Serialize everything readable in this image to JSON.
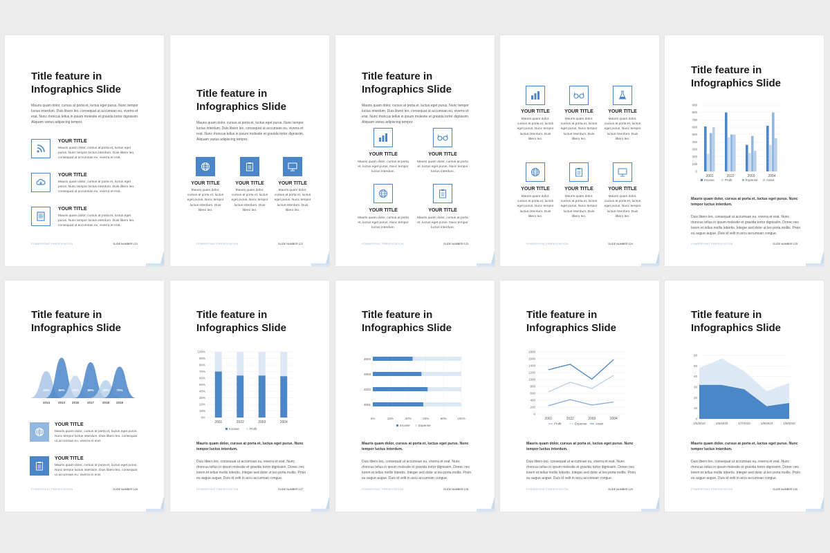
{
  "common": {
    "title_line1": "Title feature in",
    "title_line2": "Infographics Slide",
    "footer_left": "POWERPOINT PRESENTATION",
    "intro": "Mauris quam dolor, cursus at porta et, luctus eget purus. Nunc tempor luctus interdum. Duis libero leo, consequat ut accumsan eu, viverra et erat. Nunc rhoncus tellus in ipsum molestie et gravida tortor dignissim. Aliquam varius adipiscing tempor.",
    "item_title": "YOUR TITLE",
    "item_text_wide": "Mauris quam dolor, cursus at porta et, luctus eget purus. Nunc tempor luctus interdum. Duis libero leo, consequat ut accumsan eu, viverra et erat.",
    "item_text_narrow": "Mauris quam dolor, cursus at porta et, luctus eget purus. Nunc tempor luctus interdum.",
    "item_text_col": "Mauris quam dolor, cursus at porta et, luctus eget purus. Nunc tempor luctus interdum. Duis libero leo.",
    "lead": "Mauris quam dolor, cursus at porta et, luctus eget purus. Nunc tempor luctus interdum.",
    "body": "Duis libero leo, consequat ut accumsan eu, viverra et erat. Nunc rhoncus tellus in ipsum molestie et gravida tortor dignissim. Donec nec lorem et tellus mollis lobortis. Integer sed dolor ut leo porta mollis. Proin eu augue augue. Duis id velit in arcu accumsan congue."
  },
  "slides": {
    "s121": "SLIDE NUMBER 121",
    "s122": "SLIDE NUMBER 122",
    "s123": "SLIDE NUMBER 123",
    "s124": "SLIDE NUMBER 124",
    "s125": "SLIDE NUMBER 125",
    "s126": "SLIDE NUMBER 126",
    "s127": "SLIDE NUMBER 127",
    "s128": "SLIDE NUMBER 128",
    "s129": "SLIDE NUMBER 129",
    "s130": "SLIDE NUMBER 130"
  },
  "colors": {
    "accent": "#4a86c8",
    "accent_light": "#93b8df",
    "accent_pale": "#c9daf0",
    "accent_dark": "#3a75b8"
  },
  "chart_data": [
    {
      "type": "bar",
      "categories": [
        "2001",
        "2022",
        "2003",
        "2004"
      ],
      "series": [
        {
          "name": "Income",
          "values": [
            610,
            800,
            360,
            620
          ]
        },
        {
          "name": "Profit",
          "values": [
            240,
            460,
            250,
            360
          ]
        },
        {
          "name": "Expense",
          "values": [
            520,
            500,
            480,
            800
          ]
        },
        {
          "name": "Asset",
          "values": [
            600,
            500,
            280,
            450
          ]
        }
      ],
      "ylim": [
        0,
        900
      ],
      "yticks": [
        "0",
        "100",
        "200",
        "300",
        "400",
        "500",
        "600",
        "700",
        "800",
        "900"
      ]
    },
    {
      "type": "area",
      "categories": [
        "2014",
        "2013",
        "2016",
        "2017",
        "2018",
        "2019"
      ],
      "labels": [
        "60%",
        "90%",
        "50%",
        "80%",
        "40%",
        "70%"
      ],
      "values": [
        60,
        90,
        50,
        80,
        40,
        70
      ]
    },
    {
      "type": "bar",
      "categories": [
        "2001",
        "2022",
        "2003",
        "2004"
      ],
      "series": [
        {
          "name": "Income",
          "values": [
            70,
            64,
            64,
            63
          ]
        },
        {
          "name": "Profit",
          "values": [
            30,
            36,
            36,
            37
          ]
        }
      ],
      "ylim": [
        0,
        100
      ],
      "yticks": [
        "0%",
        "10%",
        "20%",
        "30%",
        "40%",
        "50%",
        "60%",
        "70%",
        "80%",
        "90%",
        "100%"
      ]
    },
    {
      "type": "bar",
      "orientation": "horizontal",
      "categories": [
        "2004",
        "2003",
        "2022",
        "2001"
      ],
      "series": [
        {
          "name": "Income",
          "values": [
            45,
            55,
            62,
            57
          ]
        },
        {
          "name": "Expense",
          "values": [
            55,
            45,
            38,
            43
          ]
        }
      ],
      "xticks": [
        "0%",
        "20%",
        "40%",
        "60%",
        "80%",
        "100%"
      ]
    },
    {
      "type": "line",
      "categories": [
        "2001",
        "2022",
        "2003",
        "2004"
      ],
      "series": [
        {
          "name": "Profit",
          "values": [
            240,
            420,
            260,
            350
          ]
        },
        {
          "name": "Expense",
          "values": [
            640,
            920,
            740,
            1120
          ]
        },
        {
          "name": "Asset",
          "values": [
            1280,
            1440,
            1010,
            1580
          ]
        }
      ],
      "ylim": [
        0,
        1800
      ],
      "yticks": [
        "0",
        "200",
        "400",
        "600",
        "800",
        "1000",
        "1200",
        "1400",
        "1600",
        "1800"
      ]
    },
    {
      "type": "area",
      "categories": [
        "1/5/2010",
        "1/6/2010",
        "1/7/2010",
        "1/8/2010",
        "1/9/2010"
      ],
      "series": [
        {
          "name": "Series 1",
          "values": [
            48,
            57,
            45,
            26,
            34
          ]
        },
        {
          "name": "Series 2",
          "values": [
            32,
            32,
            28,
            12,
            15
          ]
        }
      ],
      "ylim": [
        0,
        60
      ],
      "yticks": [
        "0",
        "10",
        "20",
        "30",
        "40",
        "50",
        "60"
      ]
    }
  ]
}
